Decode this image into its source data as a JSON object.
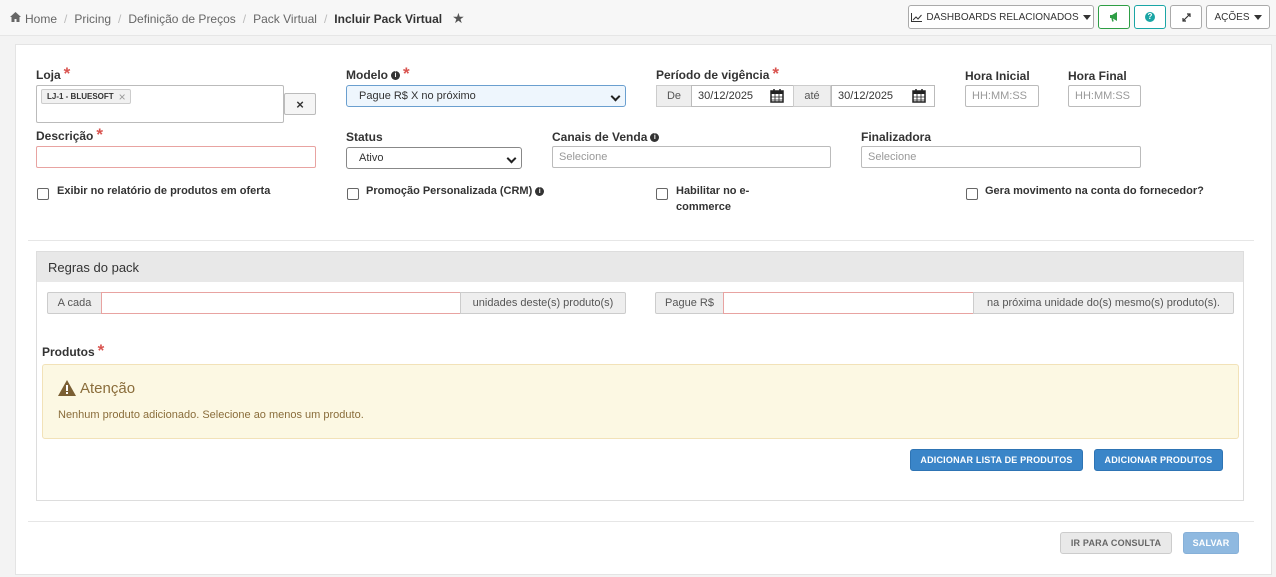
{
  "breadcrumb": {
    "home": "Home",
    "items": [
      "Pricing",
      "Definição de Preços",
      "Pack Virtual"
    ],
    "current": "Incluir Pack Virtual"
  },
  "toolbar": {
    "dashboards": "DASHBOARDS RELACIONADOS",
    "acoes": "AÇÕES"
  },
  "form": {
    "loja": {
      "label": "Loja",
      "tag": "LJ-1 - BLUESOFT",
      "tag_remove": "×",
      "clear": "×"
    },
    "modelo": {
      "label": "Modelo",
      "value": "Pague R$ X no próximo"
    },
    "periodo": {
      "label": "Período de vigência",
      "de": "De",
      "inicio": "30/12/2025",
      "ate": "até",
      "fim": "30/12/2025"
    },
    "hora_inicial": {
      "label": "Hora Inicial",
      "placeholder": "HH:MM:SS"
    },
    "hora_final": {
      "label": "Hora Final",
      "placeholder": "HH:MM:SS"
    },
    "descricao": {
      "label": "Descrição",
      "value": ""
    },
    "status": {
      "label": "Status",
      "value": "Ativo"
    },
    "canais": {
      "label": "Canais de Venda",
      "placeholder": "Selecione"
    },
    "finalizadora": {
      "label": "Finalizadora",
      "placeholder": "Selecione"
    },
    "checkboxes": [
      "Exibir no relatório de produtos em oferta",
      "Promoção Personalizada (CRM)",
      "Habilitar no e-commerce",
      "Gera movimento na conta do fornecedor?"
    ]
  },
  "regras": {
    "title": "Regras do pack",
    "a_cada": "A cada",
    "unidades": "unidades deste(s) produto(s)",
    "pague": "Pague R$",
    "proxima": "na próxima unidade do(s) mesmo(s) produto(s)."
  },
  "produtos": {
    "label": "Produtos",
    "alert_title": "Atenção",
    "alert_text": "Nenhum produto adicionado. Selecione ao menos um produto.",
    "add_lista": "ADICIONAR LISTA DE PRODUTOS",
    "add": "ADICIONAR PRODUTOS"
  },
  "footer": {
    "consulta": "IR PARA CONSULTA",
    "salvar": "SALVAR"
  },
  "colors": {
    "accent": "#3a85c8",
    "required": "#d9534f",
    "alert_bg": "#fcf8e3",
    "alert_text": "#8a6d3b",
    "success": "#2e9e45",
    "teal": "#1aa5a5"
  }
}
